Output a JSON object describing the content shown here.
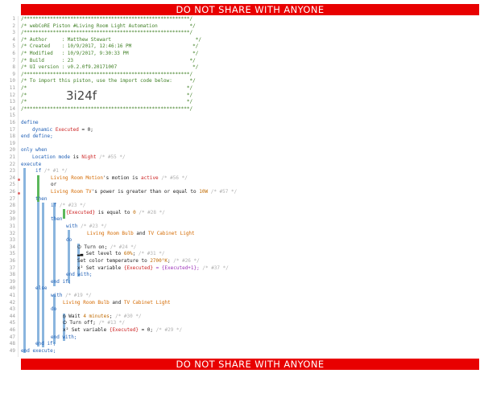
{
  "banner": {
    "top": "DO NOT SHARE WITH ANYONE",
    "bottom": "DO NOT SHARE WITH ANYONE"
  },
  "line_numbers": [
    "1",
    "2",
    "3",
    "4",
    "5",
    "6",
    "7",
    "8",
    "9",
    "10",
    "11",
    "12",
    "13",
    "14",
    "15",
    "16",
    "17",
    "18",
    "19",
    "20",
    "21",
    "22",
    "23",
    "24",
    "25",
    "26",
    "27",
    "28",
    "29",
    "30",
    "31",
    "32",
    "33",
    "34",
    "35",
    "36",
    "37",
    "38",
    "39",
    "40",
    "41",
    "42",
    "43",
    "44",
    "45",
    "46",
    "47",
    "48",
    "49"
  ],
  "header": {
    "rule": "/*********************************************************/",
    "title": "/* webCoRE Piston #Living Room Light Automation           */",
    "author": "/* Author     : Matthew Stewart                             */",
    "created": "/* Created    : 10/9/2017, 12:46:16 PM                     */",
    "modified": "/* Modified   : 10/9/2017, 9:30:33 PM                      */",
    "build": "/* Build      : 23                                        */",
    "ui_version": "/* UI version : v0.2.0f9.20171007                          */",
    "import_text": "/* To import this piston, use the import code below:      */",
    "import_blank": "/*                                                       */",
    "import_end": "/*                                                       */",
    "import_code": "3i24f"
  },
  "code": {
    "define": "define",
    "dynamic_kw": "dynamic",
    "executed_var": "Executed",
    "assign_zero": " = 0;",
    "end_define": "end define;",
    "only_when": "only when",
    "location_mode": "Location mode",
    "is_kw": " is ",
    "night": "Night",
    "c855": "/* #55 */",
    "execute": "execute",
    "if_kw": "if",
    "c1": "/* #1 */",
    "lr_motion": "Living Room Motion",
    "motion_is": "'s motion is ",
    "active": "active",
    "c856": "/* #56 */",
    "or_kw": "or",
    "lr_tv": "Living Room TV",
    "power_is": "'s power is greater than or equal to ",
    "ten_w": "10W",
    "c857": "/* #57 */",
    "then_kw": "then",
    "c823": "/* #23 */",
    "executed_paren": "{Executed}",
    "is_equal_to": " is equal to ",
    "zero": "0",
    "c828": "/* #28 */",
    "with_kw": "with",
    "lr_bulb": "Living Room Bulb",
    "and_kw": " and ",
    "tv_cabinet": "TV Cabinet Light",
    "do_kw": "do",
    "turn_on": "Turn on;",
    "c824": "/* #24 */",
    "set_level": "Set level to ",
    "sixty": "60%",
    "c831": "/* #31 */",
    "set_color_temp": "Set color temperature to ",
    "k2700": "2700°K",
    "c826": "/* #26 */",
    "set_variable": "Set variable ",
    "executed_plus": " = {Executed+1};",
    "c837": "/* #37 */",
    "end_with": "end with;",
    "end_if": "end if;",
    "else_kw": "else",
    "c819": "/* #19 */",
    "wait": "Wait ",
    "four_min": "4 minutes",
    "semi": ";",
    "c830": "/* #30 */",
    "turn_off": "Turn off;",
    "c813": "/* #13 */",
    "zero_assign": " = 0;",
    "c829": "/* #29 */",
    "end_execute": "end execute;",
    "semicolon_after_comment": ";"
  },
  "icons": {
    "power": "power-icon",
    "signal": "signal-bars-icon",
    "variable": "variable-x2-icon",
    "clock": "clock-icon"
  }
}
